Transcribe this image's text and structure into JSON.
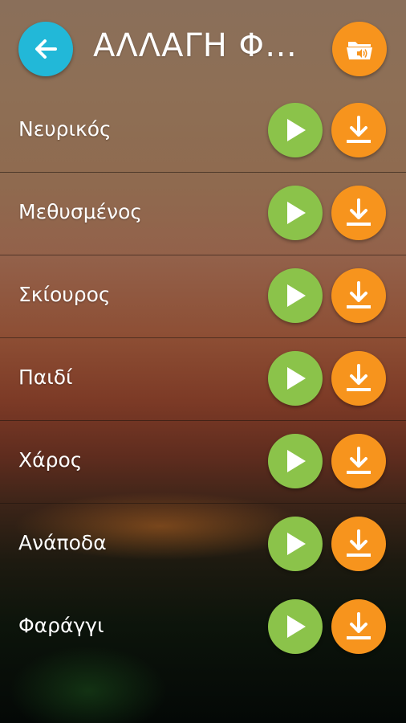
{
  "header": {
    "title": "ΑΛΛΑΓΗ Φ…",
    "back_icon": "arrow-left-icon",
    "folder_icon": "sound-folder-icon"
  },
  "colors": {
    "back_button": "#22b8d8",
    "play_button": "#8bc34a",
    "download_button": "#f7941d"
  },
  "sounds": [
    {
      "label": "Νευρικός"
    },
    {
      "label": "Μεθυσμένος"
    },
    {
      "label": "Σκίουρος"
    },
    {
      "label": "Παιδί"
    },
    {
      "label": "Χάρος"
    },
    {
      "label": "Ανάποδα"
    },
    {
      "label": "Φαράγγι"
    }
  ]
}
